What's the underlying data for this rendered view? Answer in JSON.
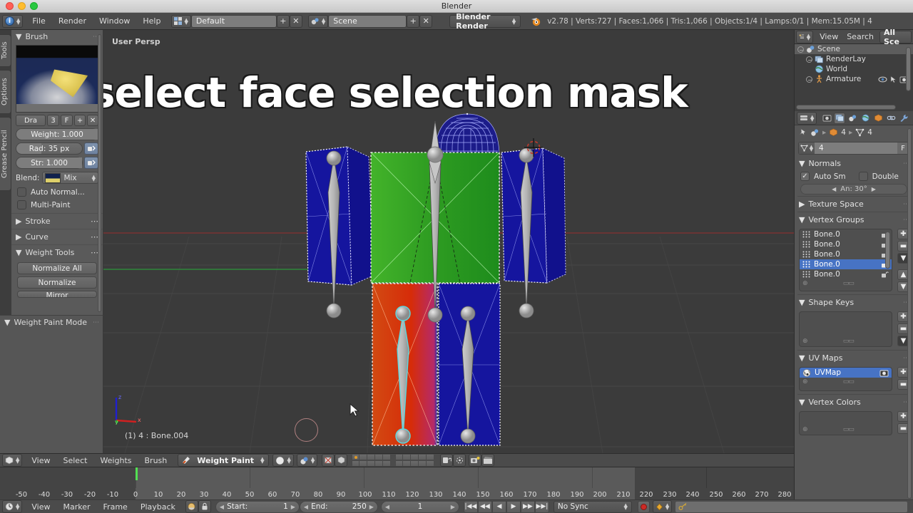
{
  "window": {
    "title": "Blender"
  },
  "topbar": {
    "menus": [
      "File",
      "Render",
      "Window",
      "Help"
    ],
    "screen_layout": "Default",
    "scene_name": "Scene",
    "render_engine": "Blender Render",
    "status": "v2.78 | Verts:727 | Faces:1,066 | Tris:1,066 | Objects:1/4 | Lamps:0/1 | Mem:15.05M | 4",
    "add_label": "+",
    "delete_label": "✕"
  },
  "toolshelf": {
    "tabs": [
      "Tools",
      "Options",
      "Grease Pencil"
    ],
    "brush_panel": {
      "title": "Brush"
    },
    "brush_row": {
      "name": "Dra",
      "users": "3",
      "fake_user": "F",
      "new": "+",
      "unlink": "✕"
    },
    "weight": "Weight:  1.000",
    "radius": "Rad: 35 px",
    "strength": "Str:  1.000",
    "blend_label": "Blend:",
    "blend_value": "Mix",
    "auto_normalize": "Auto Normal...",
    "multi_paint": "Multi-Paint",
    "stroke_panel": "Stroke",
    "curve_panel": "Curve",
    "weight_tools_panel": "Weight Tools",
    "buttons": [
      "Normalize All",
      "Normalize",
      "Mirror"
    ],
    "mode_panel": "Weight Paint Mode"
  },
  "viewport": {
    "view_label": "User Persp",
    "overlay_text": "select face selection mask",
    "status_text": "(1) 4 : Bone.004",
    "axis": {
      "x": "x",
      "y": "y",
      "z": "z"
    }
  },
  "viewport_header": {
    "menus": [
      "View",
      "Select",
      "Weights",
      "Brush"
    ],
    "mode": "Weight Paint",
    "layers_row1": [
      true,
      false,
      false,
      false,
      false,
      false,
      false,
      false,
      false,
      false
    ],
    "layers_row2": [
      false,
      false,
      false,
      false,
      false,
      false,
      false,
      false,
      false,
      false
    ]
  },
  "outliner": {
    "menus": [
      "View",
      "Search"
    ],
    "filter": "All Sce",
    "rows": [
      {
        "label": "Scene",
        "indent": 0,
        "selected": true
      },
      {
        "label": "RenderLay",
        "indent": 1,
        "selected": false
      },
      {
        "label": "World",
        "indent": 1,
        "selected": false
      },
      {
        "label": "Armature",
        "indent": 1,
        "selected": false
      }
    ]
  },
  "properties": {
    "breadcrumb": {
      "object": "4",
      "data": "4"
    },
    "datablock_value": "4",
    "datablock_fake_user": "F",
    "normals": {
      "title": "Normals",
      "auto_smooth": "Auto Sm",
      "double_sided": "Double",
      "angle": "An: 30°"
    },
    "texture_space": "Texture Space",
    "vertex_groups": {
      "title": "Vertex Groups",
      "items": [
        {
          "label": "Bone.0",
          "selected": false
        },
        {
          "label": "Bone.0",
          "selected": false
        },
        {
          "label": "Bone.0",
          "selected": false
        },
        {
          "label": "Bone.0",
          "selected": true
        },
        {
          "label": "Bone.0",
          "selected": false
        }
      ]
    },
    "shape_keys": {
      "title": "Shape Keys",
      "items": []
    },
    "uv_maps": {
      "title": "UV Maps",
      "items": [
        {
          "label": "UVMap",
          "selected": true
        }
      ]
    },
    "vertex_colors": {
      "title": "Vertex Colors",
      "items": []
    }
  },
  "timeline": {
    "menus": [
      "View",
      "Marker",
      "Frame",
      "Playback"
    ],
    "start_label": "Start:",
    "start_value": "1",
    "end_label": "End:",
    "end_value": "250",
    "current_frame": "1",
    "sync_mode": "No Sync",
    "ticks": [
      "-50",
      "-40",
      "-30",
      "-20",
      "-10",
      "0",
      "10",
      "20",
      "30",
      "40",
      "50",
      "60",
      "70",
      "80",
      "90",
      "100",
      "110",
      "120",
      "130",
      "140",
      "150",
      "160",
      "170",
      "180",
      "190",
      "200",
      "210",
      "220",
      "230",
      "240",
      "250",
      "260",
      "270",
      "280"
    ]
  },
  "colors": {
    "accent_blue": "#4773c4",
    "weight_high": "#d63a10",
    "weight_mid": "#3ab82e",
    "weight_low": "#1515a8",
    "playhead_green": "#53e053",
    "record_red": "#cc2b26"
  }
}
